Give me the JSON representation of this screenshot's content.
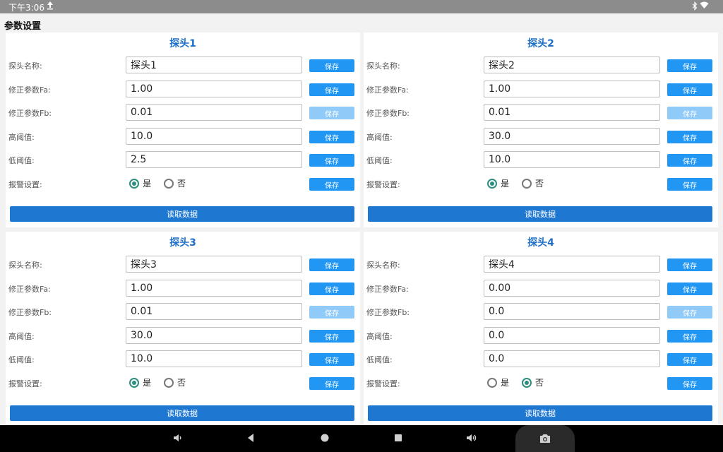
{
  "status": {
    "time": "下午3:06"
  },
  "page_title": "参数设置",
  "labels": {
    "name": "探头名称:",
    "fa": "修正参数Fa:",
    "fb": "修正参数Fb:",
    "high": "高阈值:",
    "low": "低阈值:",
    "alarm": "报警设置:",
    "save": "保存",
    "read": "读取数据",
    "yes": "是",
    "no": "否"
  },
  "probes": [
    {
      "title": "探头1",
      "name": "探头1",
      "fa": "1.00",
      "fb": "0.01",
      "high": "10.0",
      "low": "2.5",
      "alarm": "是"
    },
    {
      "title": "探头2",
      "name": "探头2",
      "fa": "1.00",
      "fb": "0.01",
      "high": "30.0",
      "low": "10.0",
      "alarm": "是"
    },
    {
      "title": "探头3",
      "name": "探头3",
      "fa": "1.00",
      "fb": "0.01",
      "high": "30.0",
      "low": "10.0",
      "alarm": "是"
    },
    {
      "title": "探头4",
      "name": "探头4",
      "fa": "0.00",
      "fb": "0.0",
      "high": "0.0",
      "low": "0.0",
      "alarm": "否"
    }
  ],
  "icons": {
    "upload": "upload-icon",
    "bluetooth": "bluetooth-icon",
    "wifi": "wifi-icon",
    "volume_down": "volume-down-icon",
    "back": "back-icon",
    "home": "home-icon",
    "recents": "recents-icon",
    "volume_up": "volume-up-icon",
    "camera": "camera-icon"
  },
  "colors": {
    "accent": "#2196f3",
    "title": "#1e6fc7",
    "radio_on": "#2c8e7e",
    "save_disabled": "#90caf9"
  }
}
